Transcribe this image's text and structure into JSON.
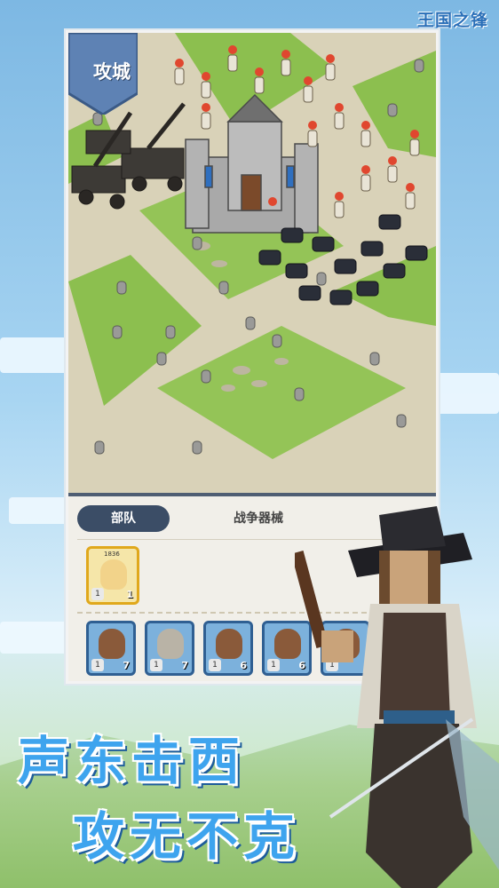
{
  "app": {
    "logo_text": "王国之锋"
  },
  "map": {
    "mode_badge": "攻城"
  },
  "panel": {
    "tabs": [
      {
        "label": "部队",
        "active": true
      },
      {
        "label": "战争器械",
        "active": false
      }
    ],
    "hero": {
      "power": "1836",
      "level": "1",
      "count": "1"
    },
    "units": [
      {
        "level": "1",
        "count": "7",
        "icon": "knight-icon"
      },
      {
        "level": "1",
        "count": "7",
        "icon": "shield-icon"
      },
      {
        "level": "1",
        "count": "6",
        "icon": "crossed-swords-icon"
      },
      {
        "level": "1",
        "count": "6",
        "icon": "crossed-swords-icon"
      },
      {
        "level": "1",
        "count": "",
        "icon": "crossed-swords-icon"
      }
    ]
  },
  "promo": {
    "line1": "声东击西",
    "line2": "攻无不克"
  },
  "colors": {
    "accent": "#3ea4ee",
    "tab_active": "#3b4d66",
    "hero_border": "#e0a81c"
  }
}
